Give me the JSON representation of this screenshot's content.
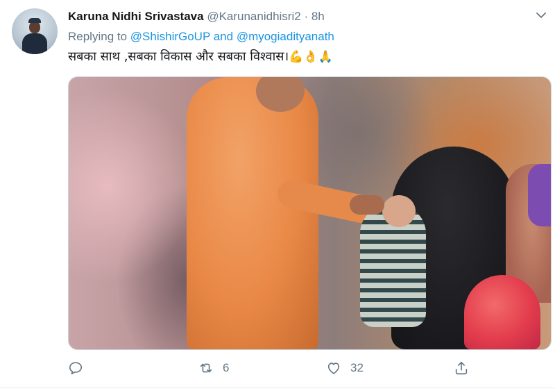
{
  "tweet": {
    "author_name": "Karuna Nidhi Srivastava",
    "handle": "@Karunanidhisri2",
    "separator": "·",
    "time": "8h",
    "replying_prefix": "Replying to ",
    "reply_mention_1": "@ShishirGoUP",
    "reply_conj": " and ",
    "reply_mention_2": "@myogiadityanath",
    "text": "सबका साथ ,सबका विकास और सबका विश्वास।",
    "emojis": "💪👌🙏"
  },
  "media": {
    "description_icon": "photo"
  },
  "actions": {
    "reply_count": "",
    "retweet_count": "6",
    "like_count": "32"
  },
  "colors": {
    "text": "#14171a",
    "secondary": "#657786",
    "link": "#1b95e0",
    "border": "#e6ecf0"
  }
}
